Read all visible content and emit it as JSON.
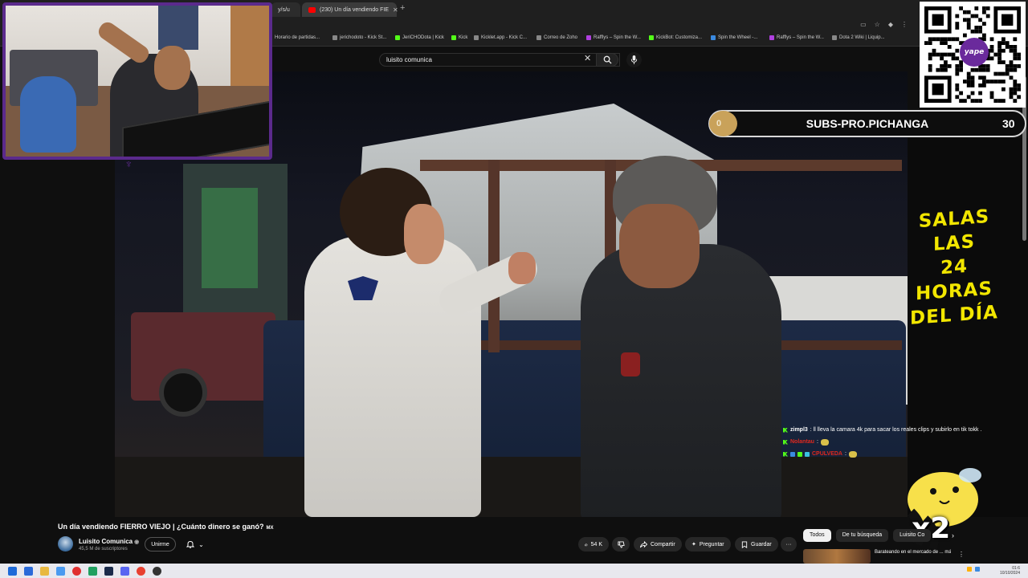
{
  "browser": {
    "tabs": [
      {
        "label": "y/s/u"
      },
      {
        "label": "(230) Un día vendiendo FIE"
      }
    ],
    "new_tab": "+",
    "bookmarks": [
      "Horario de partidas...",
      "jerichodoto - Kick St...",
      "JeriCHODota | Kick",
      "Kick",
      "Kicklet.app - Kick C...",
      "Correo de Zoho",
      "Rafflys – Spin the W...",
      "KickBot: Customiza...",
      "Spin the Wheel -...",
      "Rafflys – Spin the W...",
      "Dota 2 Wiki | Liquip..."
    ]
  },
  "youtube": {
    "search": {
      "query": "luisito comunica",
      "clear": "✕"
    },
    "video": {
      "title": "Un día vendiendo FIERRO VIEJO | ¿Cuánto dinero se ganó?",
      "country": "MX"
    },
    "channel": {
      "name": "Luisito Comunica",
      "verified": "◉",
      "subscribers": "45,5 M de suscriptores"
    },
    "buttons": {
      "join": "Unirme",
      "bell_caret": "⌄",
      "like_count": "54 K",
      "share": "Compartir",
      "ask": "Preguntar",
      "save": "Guardar",
      "more": "···"
    },
    "chips": [
      "Todos",
      "De tu búsqueda",
      "Luisito Co"
    ],
    "chip_next": "›",
    "recommendation": {
      "title": "Barateando en el mercado de ... más grande del mundo |",
      "more": "⋮"
    }
  },
  "stream": {
    "sub_goal": {
      "current": "0",
      "label": "SUBS-PRO.PICHANGA",
      "target": "30"
    },
    "promo_lines": [
      "SALAS LAS",
      "24 HORAS",
      "DEL DÍA"
    ],
    "qr_logo": "yape",
    "bee_multiplier": "x2",
    "chat": [
      {
        "user": "zimpl3",
        "user_color": "#ffffff",
        "message": ": ll lleva la camara 4k para sacar los reales clips y subirlo en tik tokk ."
      },
      {
        "user": "Nolantau",
        "user_color": "#e0281e",
        "message": ":"
      },
      {
        "user": "CPULVEDA",
        "user_color": "#e0281e",
        "message": ":"
      }
    ]
  },
  "colors": {
    "frame_purple": "#5b2a8c",
    "promo_yellow": "#f2e600",
    "kick_green": "#53fc18"
  },
  "taskbar": {
    "time": "01:6",
    "date": "10/10/2024"
  }
}
